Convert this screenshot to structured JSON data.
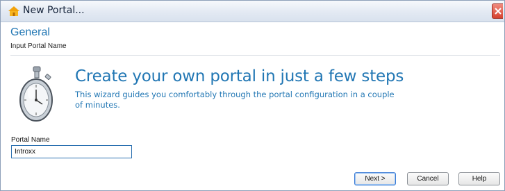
{
  "window": {
    "title": "New Portal..."
  },
  "header": {
    "section_title": "General",
    "section_subtitle": "Input Portal Name"
  },
  "intro": {
    "headline": "Create your own portal in just a few steps",
    "description": "This wizard guides you comfortably through the portal configuration in a couple of minutes."
  },
  "form": {
    "portal_name_label": "Portal Name",
    "portal_name_value": "Introxx"
  },
  "buttons": {
    "next": "Next >",
    "cancel": "Cancel",
    "help": "Help"
  },
  "colors": {
    "accent": "#2277b4",
    "close": "#d6422f"
  },
  "icons": {
    "app": "portal-icon",
    "illustration": "stopwatch-icon",
    "close": "close-icon"
  }
}
